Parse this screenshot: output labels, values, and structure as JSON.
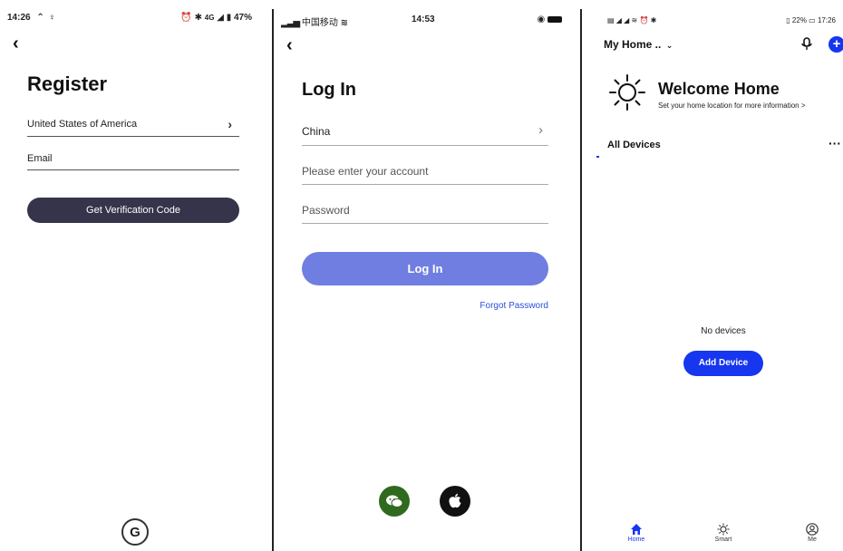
{
  "register": {
    "status_time": "14:26",
    "status_right": "47%",
    "status_network": "4G",
    "title": "Register",
    "country": "United States of America",
    "email_label": "Email",
    "button_label": "Get Verification Code",
    "button_color": "#35344a"
  },
  "login": {
    "carrier": "中国移动",
    "status_time": "14:53",
    "title": "Log In",
    "country": "China",
    "account_placeholder": "Please enter your account",
    "password_placeholder": "Password",
    "button_label": "Log In",
    "button_color": "#6f7ee0",
    "forgot_label": "Forgot Password",
    "link_color": "#2f4fd8",
    "wechat_color": "#2f6a1f"
  },
  "home": {
    "status_right": "22%",
    "status_time": "17:26",
    "home_selector": "My Home ..",
    "welcome_title": "Welcome Home",
    "welcome_subtitle": "Set your home location for more information >",
    "section_title": "All Devices",
    "empty_text": "No devices",
    "add_device_label": "Add Device",
    "accent_color": "#1636f0",
    "tabs": [
      {
        "label": "Home",
        "icon": "home-icon",
        "active": true
      },
      {
        "label": "Smart",
        "icon": "sun-icon",
        "active": false
      },
      {
        "label": "Me",
        "icon": "user-icon",
        "active": false
      }
    ]
  }
}
